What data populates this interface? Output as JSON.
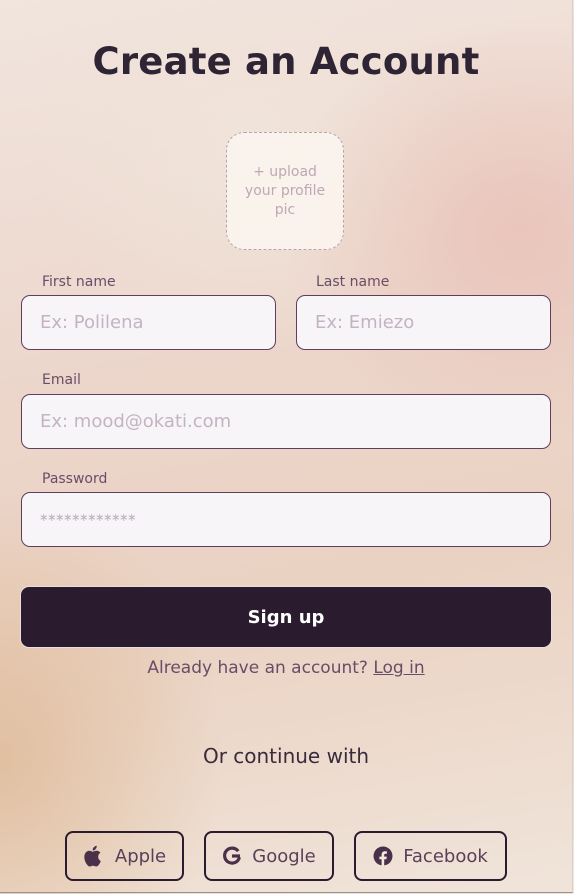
{
  "header": {
    "title": "Create an Account"
  },
  "profile_upload": {
    "label": "+ upload your profile pic"
  },
  "form": {
    "first_name": {
      "label": "First name",
      "placeholder": "Ex: Polilena",
      "value": ""
    },
    "last_name": {
      "label": "Last name",
      "placeholder": "Ex: Emiezo",
      "value": ""
    },
    "email": {
      "label": "Email",
      "placeholder": "Ex: mood@okati.com",
      "value": ""
    },
    "password": {
      "label": "Password",
      "placeholder": "************",
      "value": ""
    }
  },
  "actions": {
    "signup_label": "Sign up",
    "login_prompt": "Already have an account?",
    "login_link": "Log in"
  },
  "social": {
    "heading": "Or continue with",
    "providers": [
      {
        "label": "Apple",
        "icon": "apple-icon"
      },
      {
        "label": "Google",
        "icon": "google-icon"
      },
      {
        "label": "Facebook",
        "icon": "facebook-icon"
      }
    ]
  },
  "colors": {
    "primary": "#2b1b2f",
    "label": "#6a4c68",
    "placeholder": "#c4b3c2",
    "input_border": "#5f3f5c"
  }
}
